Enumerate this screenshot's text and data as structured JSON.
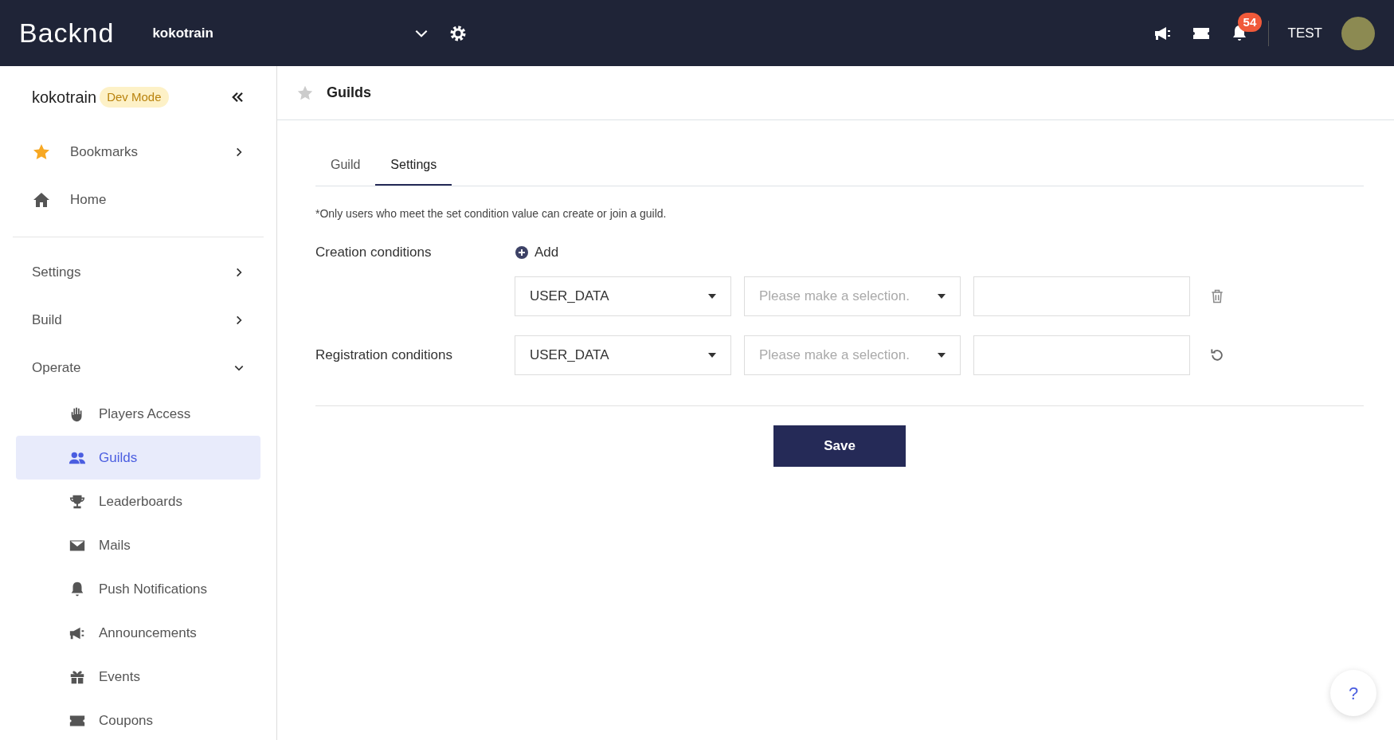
{
  "topbar": {
    "logo": "Backnd",
    "project": "kokotrain",
    "notification_count": "54",
    "user": "TEST"
  },
  "sidebar": {
    "project": "kokotrain",
    "badge": "Dev Mode",
    "top_items": [
      {
        "label": "Bookmarks",
        "kind": "star",
        "has_arrow": true
      },
      {
        "label": "Home",
        "kind": "home",
        "has_arrow": false
      }
    ],
    "sections": [
      {
        "label": "Settings",
        "expanded": false
      },
      {
        "label": "Build",
        "expanded": false
      },
      {
        "label": "Operate",
        "expanded": true,
        "children": [
          {
            "label": "Players Access",
            "kind": "hand",
            "selected": false
          },
          {
            "label": "Guilds",
            "kind": "users",
            "selected": true
          },
          {
            "label": "Leaderboards",
            "kind": "trophy",
            "selected": false
          },
          {
            "label": "Mails",
            "kind": "mail",
            "selected": false
          },
          {
            "label": "Push Notifications",
            "kind": "bell",
            "selected": false
          },
          {
            "label": "Announcements",
            "kind": "megaphone",
            "selected": false
          },
          {
            "label": "Events",
            "kind": "gift",
            "selected": false
          },
          {
            "label": "Coupons",
            "kind": "ticket",
            "selected": false
          }
        ]
      }
    ]
  },
  "page": {
    "title": "Guilds",
    "bookmarked": false,
    "tabs": [
      {
        "label": "Guild",
        "selected": false
      },
      {
        "label": "Settings",
        "selected": true
      }
    ],
    "note": "*Only users who meet the set condition value can create or join a guild.",
    "add_label": "Add",
    "conditions": [
      {
        "label": "Creation conditions",
        "type": "USER_DATA",
        "placeholder": "Please make a selection.",
        "kind": "delete",
        "has_add": true
      },
      {
        "label": "Registration conditions",
        "type": "USER_DATA",
        "placeholder": "Please make a selection.",
        "kind": "reset",
        "has_add": false
      }
    ],
    "save": "Save",
    "help": "?"
  }
}
